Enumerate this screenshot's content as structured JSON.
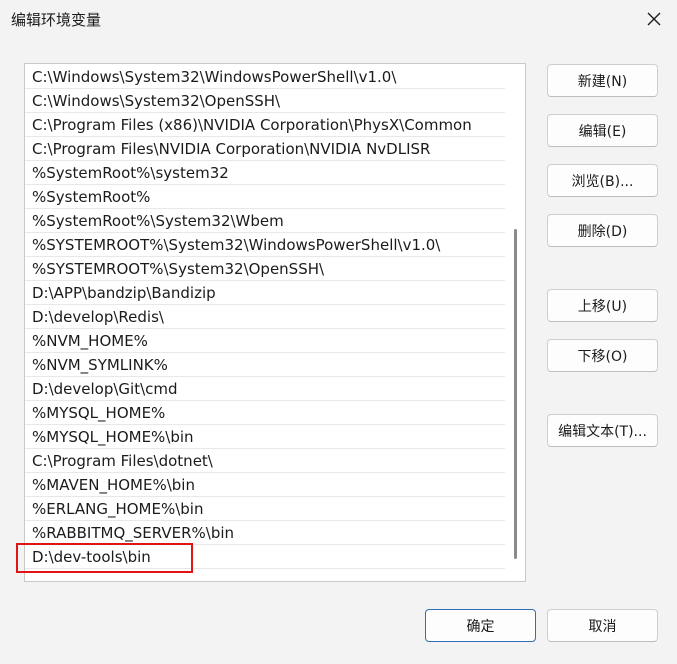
{
  "window": {
    "title": "编辑环境变量"
  },
  "path_list": [
    "C:\\Windows\\System32\\WindowsPowerShell\\v1.0\\",
    "C:\\Windows\\System32\\OpenSSH\\",
    "C:\\Program Files (x86)\\NVIDIA Corporation\\PhysX\\Common",
    "C:\\Program Files\\NVIDIA Corporation\\NVIDIA NvDLISR",
    "%SystemRoot%\\system32",
    "%SystemRoot%",
    "%SystemRoot%\\System32\\Wbem",
    "%SYSTEMROOT%\\System32\\WindowsPowerShell\\v1.0\\",
    "%SYSTEMROOT%\\System32\\OpenSSH\\",
    "D:\\APP\\bandzip\\Bandizip",
    "D:\\develop\\Redis\\",
    "%NVM_HOME%",
    "%NVM_SYMLINK%",
    "D:\\develop\\Git\\cmd",
    "%MYSQL_HOME%",
    "%MYSQL_HOME%\\bin",
    "C:\\Program Files\\dotnet\\",
    "%MAVEN_HOME%\\bin",
    "%ERLANG_HOME%\\bin",
    "%RABBITMQ_SERVER%\\bin",
    "D:\\dev-tools\\bin"
  ],
  "buttons": {
    "new": "新建(N)",
    "edit": "编辑(E)",
    "browse": "浏览(B)...",
    "delete": "删除(D)",
    "move_up": "上移(U)",
    "move_down": "下移(O)",
    "edit_text": "编辑文本(T)...",
    "ok": "确定",
    "cancel": "取消"
  },
  "colors": {
    "highlight_box": "#e01414",
    "primary_border": "#2f6fba"
  },
  "icons": {
    "close": "close-icon"
  }
}
